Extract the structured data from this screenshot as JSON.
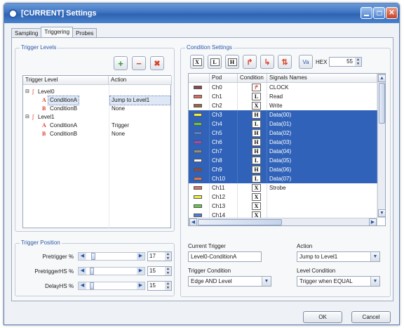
{
  "window": {
    "title": "[CURRENT] Settings"
  },
  "tabs": [
    "Sampling",
    "Triggering",
    "Probes"
  ],
  "trigger_levels": {
    "group_label": "Trigger Levels",
    "columns": [
      "Trigger Level",
      "Action"
    ],
    "rows": [
      {
        "label": "Level0",
        "action": ""
      },
      {
        "label": "ConditionA",
        "action": "Jump to Level1"
      },
      {
        "label": "ConditionB",
        "action": "None"
      },
      {
        "label": "Level1",
        "action": ""
      },
      {
        "label": "ConditionA",
        "action": "Trigger"
      },
      {
        "label": "ConditionB",
        "action": "None"
      }
    ],
    "letters": [
      "A",
      "B",
      "A",
      "B"
    ],
    "add_icon": "+",
    "remove_icon": "−",
    "delete_icon": "✖"
  },
  "trigger_position": {
    "group_label": "Trigger Position",
    "rows": [
      {
        "label": "Pretrigger %",
        "value": "17"
      },
      {
        "label": "PretriggerHS %",
        "value": "15"
      },
      {
        "label": "DelayHS %",
        "value": "15"
      }
    ]
  },
  "condition_settings": {
    "group_label": "Condition Settings",
    "toolbar": [
      "X",
      "L",
      "H",
      "rise",
      "fall",
      "edge"
    ],
    "va_label": "Va",
    "hex_label": "HEX",
    "hex_value": "55",
    "columns": [
      "Pod",
      "Condition",
      "Signals Names"
    ],
    "rows": [
      {
        "pod": "Ch0",
        "cond": "rise",
        "signal": "CLOCK",
        "color": "#8a4a52",
        "hl": false
      },
      {
        "pod": "Ch1",
        "cond": "L",
        "signal": "Read",
        "color": "#d9735d",
        "hl": false
      },
      {
        "pod": "Ch2",
        "cond": "X",
        "signal": "Write",
        "color": "#a0663d",
        "hl": false
      },
      {
        "pod": "Ch3",
        "cond": "H",
        "signal": "Data(00)",
        "color": "#f2ee48",
        "hl": true
      },
      {
        "pod": "Ch4",
        "cond": "L",
        "signal": "Data(01)",
        "color": "#63c84b",
        "hl": true
      },
      {
        "pod": "Ch5",
        "cond": "H",
        "signal": "Data(02)",
        "color": "#4d7fd8",
        "hl": true
      },
      {
        "pod": "Ch6",
        "cond": "H",
        "signal": "Data(03)",
        "color": "#9b4ac8",
        "hl": true
      },
      {
        "pod": "Ch7",
        "cond": "H",
        "signal": "Data(04)",
        "color": "#8d8d8d",
        "hl": true
      },
      {
        "pod": "Ch8",
        "cond": "L",
        "signal": "Data(05)",
        "color": "#f4f4f4",
        "hl": true
      },
      {
        "pod": "Ch9",
        "cond": "H",
        "signal": "Data(06)",
        "color": "#8a4a52",
        "hl": true
      },
      {
        "pod": "Ch10",
        "cond": "L",
        "signal": "Data(07)",
        "color": "#d9735d",
        "hl": true
      },
      {
        "pod": "Ch11",
        "cond": "X",
        "signal": "Strobe",
        "color": "#d9735d",
        "hl": false
      },
      {
        "pod": "Ch12",
        "cond": "X",
        "signal": "",
        "color": "#f2ee48",
        "hl": false
      },
      {
        "pod": "Ch13",
        "cond": "X",
        "signal": "",
        "color": "#63c84b",
        "hl": false
      },
      {
        "pod": "Ch14",
        "cond": "X",
        "signal": "",
        "color": "#4d7fd8",
        "hl": false
      }
    ]
  },
  "current_trigger": {
    "label": "Current Trigger",
    "value": "Level0-ConditionA"
  },
  "action": {
    "label": "Action",
    "value": "Jump to Level1"
  },
  "trigger_condition": {
    "label": "Trigger Condition",
    "value": "Edge AND Level"
  },
  "level_condition": {
    "label": "Level Condition",
    "value": "Trigger when EQUAL"
  },
  "buttons": {
    "ok": "OK",
    "cancel": "Cancel"
  }
}
